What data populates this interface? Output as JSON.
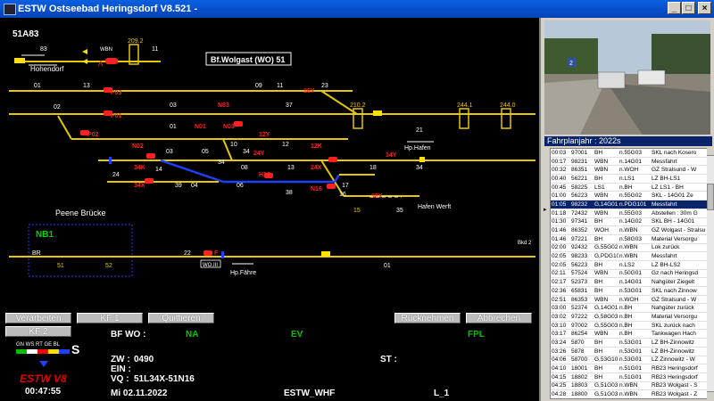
{
  "window": {
    "title": "ESTW  Ostseebad Heringsdorf  V8.521 -",
    "min": "_",
    "max": "□",
    "close": "×"
  },
  "map": {
    "station_id": "51A83",
    "station_box": "Bf.Wolgast (WO) 51",
    "peene": "Peene Brücke",
    "nb1": "NB1",
    "hohendorf": "Hohendorf",
    "hp_hafen": "Hp.Hafen",
    "hafen_werft": "Hafen  Werft",
    "hp_faehre": "Hp.Fähre",
    "wo_label": "WO.III",
    "wbn": "WBN",
    "bkd2": "Bkd 2",
    "br": "BR",
    "track_numbers": [
      "83",
      "209.2",
      "11",
      "13",
      "01",
      "09",
      "11",
      "23",
      "03",
      "37",
      "02",
      "01",
      "210.2",
      "21",
      "244.1",
      "244.0",
      "10",
      "12",
      "03",
      "05",
      "34",
      "06",
      "07",
      "18",
      "34",
      "08",
      "13",
      "24",
      "14",
      "39",
      "04",
      "06",
      "38",
      "16",
      "17",
      "15",
      "35",
      "18",
      "22",
      "52",
      "51",
      "01",
      "03",
      "11"
    ],
    "signals": [
      "A",
      "P03",
      "N83",
      "P01",
      "N01",
      "P02",
      "N02",
      "N03",
      "34K",
      "34X",
      "12K",
      "14Y",
      "24X",
      "N16",
      "12Y",
      "24Y",
      "16Y",
      "H16",
      "P15",
      "N19",
      "F",
      "18Y"
    ]
  },
  "buttons": {
    "verarbeiten": "Verarbeiten",
    "kf1": "KF 1",
    "quittieren": "Quittieren",
    "ruecknehmen": "Rücknehmen",
    "abbrechen": "Abbrechen",
    "kf2": "KF 2"
  },
  "status": {
    "bfwo_label": "BF WO :",
    "na": "NA",
    "ev": "EV",
    "fpl": "FPL",
    "zw_label": "ZW :",
    "zw_value": "0490",
    "ein_label": "EIN :",
    "vq_label": "VQ :",
    "vq_value": "51L34X-51N16",
    "st_label": "ST :",
    "date": "Mi  02.11.2022",
    "estw_whf": "ESTW_WHF",
    "l1": "L_1",
    "clock": "00:47:55",
    "logo": "ESTW V8",
    "legend": "GN WS RT GE BL",
    "s": "S"
  },
  "panel": {
    "fahrplan_title": "Fahrplanjahr : 2022s",
    "rows": [
      [
        "00:03",
        "97001",
        "BH",
        "n.55G03",
        "SKL nach Kosero"
      ],
      [
        "00:17",
        "98231",
        "WBN",
        "n.14G01",
        "Messfahrt"
      ],
      [
        "00:32",
        "86351",
        "WBN",
        "n.WOH",
        "GZ Stralsund - W"
      ],
      [
        "00:40",
        "56221",
        "BH",
        "n.LS1",
        "LZ BH-LS1"
      ],
      [
        "00:45",
        "58225",
        "LS1",
        "n.BH",
        "LZ LS1 - BH"
      ],
      [
        "01:00",
        "56223",
        "WBN",
        "n.55G02",
        "SKL - 14G01 Ze"
      ],
      [
        "01:05",
        "98232",
        "G,14G01",
        "n.PDG101",
        "Messfahrt"
      ],
      [
        "01:18",
        "72432",
        "WBN",
        "n.55G03",
        "Abstellen : 30m G"
      ],
      [
        "01:30",
        "97341",
        "BH",
        "n.14G02",
        "SKL BH - 14G01"
      ],
      [
        "01:46",
        "86352",
        "WOH",
        "n.WBN",
        "GZ Wolgast - Stralsu"
      ],
      [
        "01:46",
        "97221",
        "BH",
        "n.58G03",
        "Material Versorgu"
      ],
      [
        "02:00",
        "92432",
        "G,55G02",
        "n.WBN",
        "Lok zurück"
      ],
      [
        "02:05",
        "98233",
        "G,PDG101",
        "n.WBN",
        "Messfahrt"
      ],
      [
        "02:05",
        "56223",
        "BH",
        "n.LS2",
        "LZ BH-LS2"
      ],
      [
        "02:11",
        "57524",
        "WBN",
        "n.50G01",
        "Gz nach Heringsd"
      ],
      [
        "02:17",
        "52373",
        "BH",
        "n.14G01",
        "Nahgüter Ziegelt"
      ],
      [
        "02:36",
        "65831",
        "BH",
        "n.53G01",
        "SKL nach Zinnow"
      ],
      [
        "02:51",
        "86353",
        "WBN",
        "n.WOH",
        "GZ Stralsund - W"
      ],
      [
        "03:00",
        "52374",
        "G,14G01",
        "n.BH",
        "Nahgüter zurück"
      ],
      [
        "03:02",
        "97222",
        "G,58G03",
        "n.BH",
        "Material Versorgu"
      ],
      [
        "03:10",
        "97002",
        "G,55G03",
        "n.BH",
        "SKL zurück nach"
      ],
      [
        "03:17",
        "86254",
        "WBN",
        "n.BH",
        "Tankwagen Hach"
      ],
      [
        "03:24",
        "5870",
        "BH",
        "n.53G01",
        "LZ BH-Zinnowitz"
      ],
      [
        "03:26",
        "5878",
        "BH",
        "n.53G01",
        "LZ BH-Zinnowitz"
      ],
      [
        "04:06",
        "58700",
        "G,53G101",
        "n.53G01",
        "LZ Zinnowitz - W"
      ],
      [
        "04:10",
        "18001",
        "BH",
        "n.51G01",
        "RB23 Heringsdorf"
      ],
      [
        "04:15",
        "18802",
        "BH",
        "n.51G01",
        "RB23 Heringsdorf"
      ],
      [
        "04:25",
        "18803",
        "G,51G03",
        "n.WBN",
        "RB23 Wolgast - S"
      ],
      [
        "04:28",
        "18800",
        "G,51G03",
        "n.WBN",
        "RB23 Wolgast - Z"
      ]
    ],
    "selected_index": 6
  }
}
